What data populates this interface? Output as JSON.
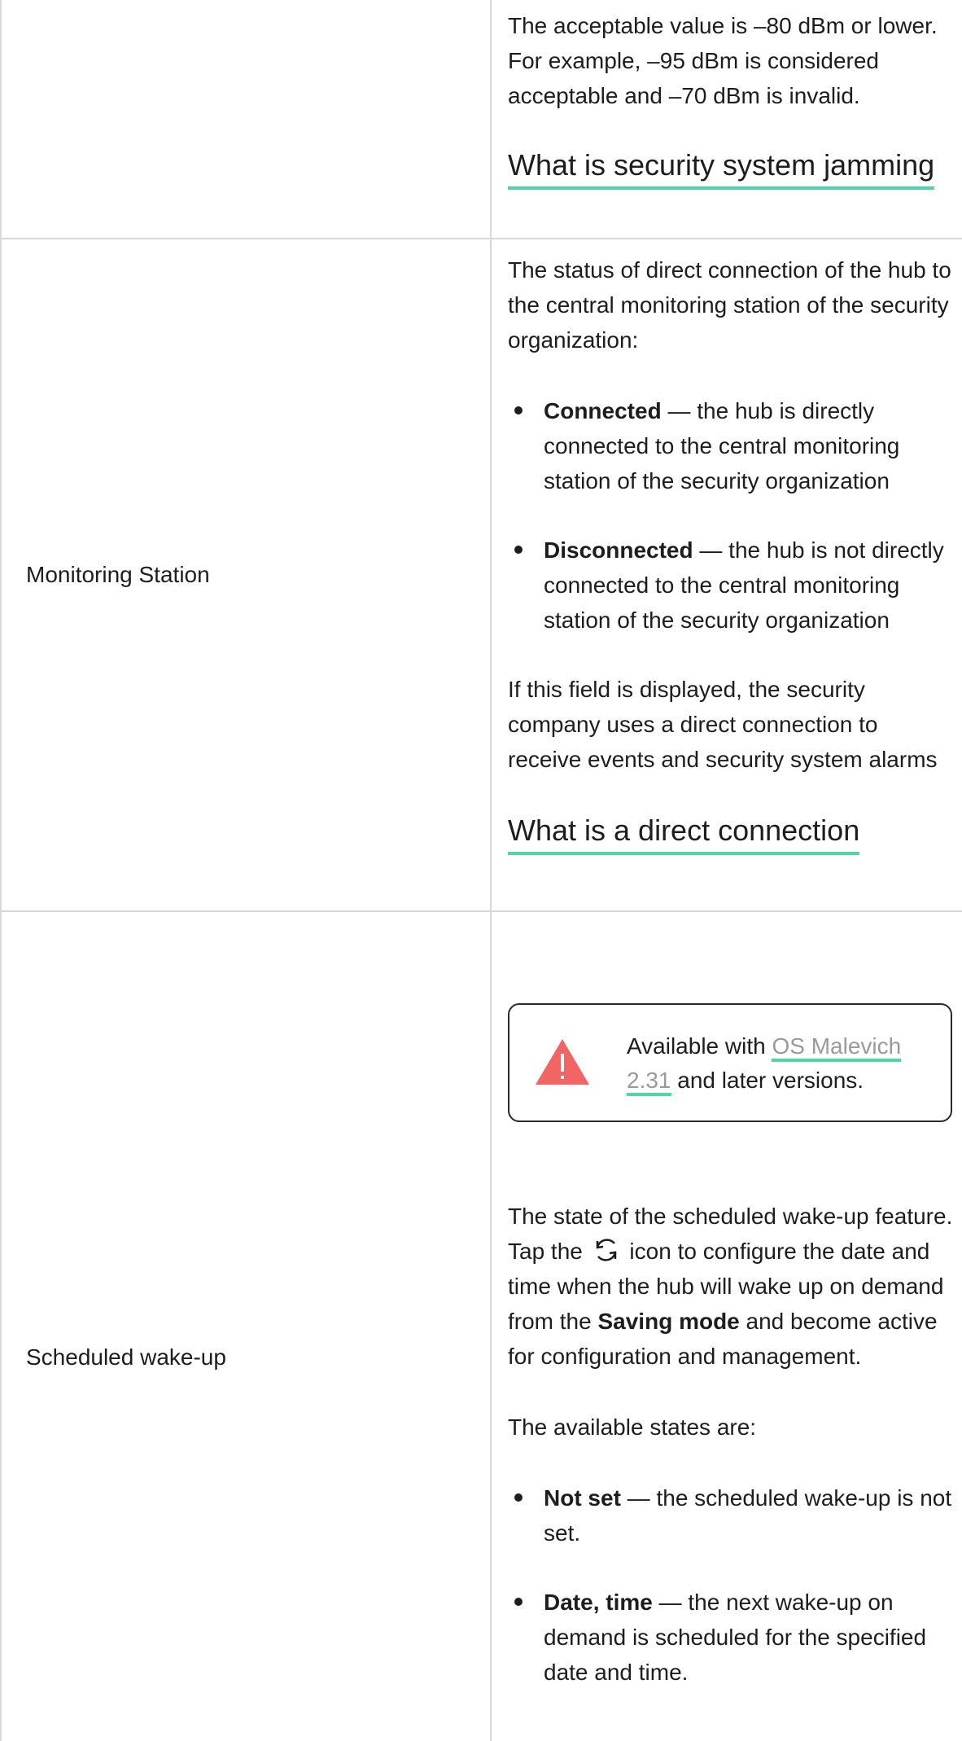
{
  "row1": {
    "description": "The acceptable value is –80 dBm or lower. For example, –95 dBm is considered acceptable and –70 dBm is invalid.",
    "link": "What is security system jamming"
  },
  "row2": {
    "label": "Monitoring Station",
    "intro": "The status of direct connection of the hub to the central monitoring station of the security organization:",
    "items": [
      {
        "term": "Connected",
        "text": " — the hub is directly connected to the central monitoring station of the security organization"
      },
      {
        "term": "Disconnected",
        "text": " — the hub is not directly connected to the central monitoring station of the security organization"
      }
    ],
    "note": "If this field is displayed, the security company uses a direct connection to receive events and security system alarms",
    "link": "What is a direct connection"
  },
  "row3": {
    "label": "Scheduled wake-up",
    "notice": {
      "prefix": "Available with ",
      "link": "OS Malevich 2.31",
      "suffix": " and later versions."
    },
    "desc_part1": "The state of the scheduled wake-up feature. Tap the",
    "desc_part2": "icon to configure the date and time when the hub will wake up on demand from the",
    "desc_bold": "Saving mode",
    "desc_part3": " and become active for configuration and management.",
    "states_intro": "The available states are:",
    "items": [
      {
        "term": "Not set",
        "text": " — the scheduled wake-up is not set."
      },
      {
        "term": "Date, time",
        "text": " — the next wake-up on demand is scheduled for the specified date and time."
      }
    ]
  },
  "icons": {
    "warning": "warning-triangle-icon",
    "refresh": "refresh-icon"
  },
  "colors": {
    "link_underline": "#4fd6a5",
    "warning": "#f26565",
    "border": "#d8d8d8"
  }
}
